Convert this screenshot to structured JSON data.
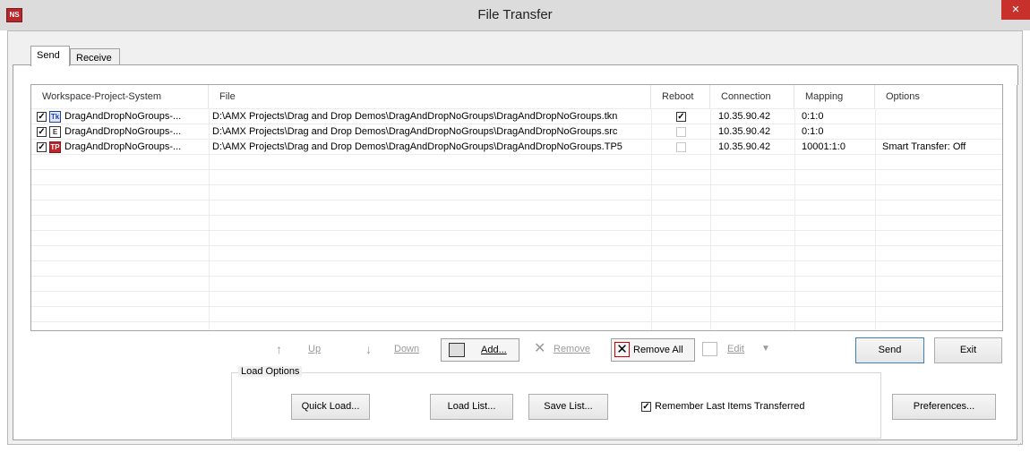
{
  "window": {
    "title": "File Transfer",
    "app_icon": "NS",
    "close": "×"
  },
  "tabs": [
    {
      "label": "Send"
    },
    {
      "label": "Receive"
    }
  ],
  "list": {
    "columns": [
      "Workspace-Project-System",
      "File",
      "Reboot",
      "Connection",
      "Mapping",
      "Options"
    ],
    "rows": [
      {
        "checked": true,
        "icon": "tkn-file-icon",
        "workspace": "DragAndDropNoGroups-...",
        "file": "D:\\AMX Projects\\Drag and Drop Demos\\DragAndDropNoGroups\\DragAndDropNoGroups.tkn",
        "reboot": true,
        "connection": "10.35.90.42",
        "mapping": "0:1:0",
        "options": ""
      },
      {
        "checked": true,
        "icon": "source-file-icon",
        "workspace": "DragAndDropNoGroups-...",
        "file": "D:\\AMX Projects\\Drag and Drop Demos\\DragAndDropNoGroups\\DragAndDropNoGroups.src",
        "reboot": false,
        "connection": "10.35.90.42",
        "mapping": "0:1:0",
        "options": ""
      },
      {
        "checked": true,
        "icon": "tp5-file-icon",
        "workspace": "DragAndDropNoGroups-...",
        "file": "D:\\AMX Projects\\Drag and Drop Demos\\DragAndDropNoGroups\\DragAndDropNoGroups.TP5",
        "reboot": false,
        "connection": "10.35.90.42",
        "mapping": "10001:1:0",
        "options": "Smart Transfer: Off"
      }
    ]
  },
  "toolbar": {
    "up": "Up",
    "down": "Down",
    "add": "Add...",
    "remove": "Remove",
    "remove_all": "Remove All",
    "edit": "Edit"
  },
  "buttons": {
    "send": "Send",
    "exit": "Exit",
    "preferences": "Preferences..."
  },
  "load_options": {
    "label": "Load Options",
    "quick_load": "Quick Load...",
    "load_list": "Load List...",
    "save_list": "Save List...",
    "remember_label": "Remember Last Items Transferred",
    "remember_checked": true
  }
}
